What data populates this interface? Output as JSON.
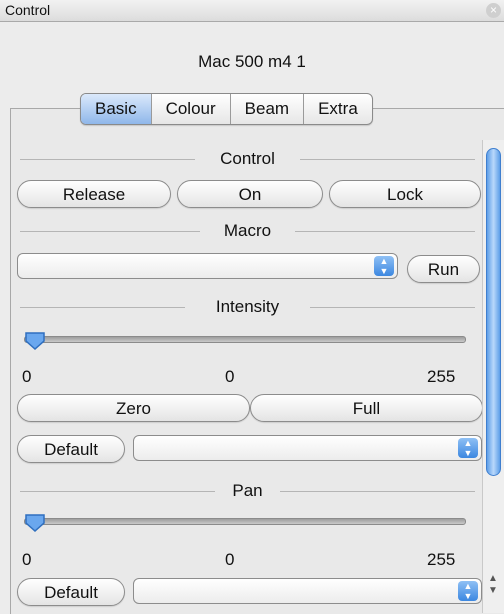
{
  "window": {
    "title": "Control"
  },
  "fixture": {
    "name": "Mac 500 m4 1"
  },
  "tabs": [
    "Basic",
    "Colour",
    "Beam",
    "Extra"
  ],
  "sections": {
    "control": {
      "label": "Control",
      "buttons": [
        "Release",
        "On",
        "Lock"
      ]
    },
    "macro": {
      "label": "Macro",
      "selected": "",
      "run_label": "Run"
    },
    "intensity": {
      "label": "Intensity",
      "value": 0,
      "min_label": "0",
      "value_label": "0",
      "max_label": "255",
      "zero_label": "Zero",
      "full_label": "Full",
      "default_label": "Default",
      "preset_selected": ""
    },
    "pan": {
      "label": "Pan",
      "value": 0,
      "min_label": "0",
      "value_label": "0",
      "max_label": "255",
      "default_label": "Default",
      "preset_selected": ""
    }
  },
  "colors": {
    "accent": "#3c87e0",
    "selected_tab": "#8fb7ea"
  },
  "icons": {
    "close": "close-icon",
    "select": "updown-arrows-icon"
  }
}
